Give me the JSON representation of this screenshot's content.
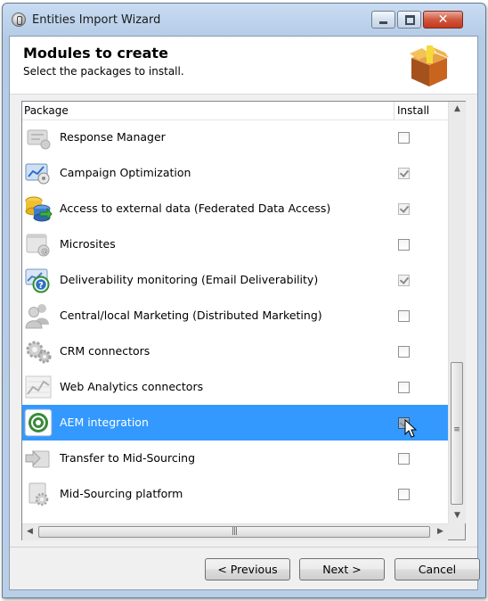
{
  "window": {
    "title": "Entities Import Wizard",
    "close_glyph": "✕"
  },
  "header": {
    "title": "Modules to create",
    "subtitle": "Select the packages to install.",
    "icon": "package-box-icon"
  },
  "list": {
    "columns": [
      "Package",
      "Install"
    ],
    "rows": [
      {
        "label": "Response Manager",
        "icon": "response-manager-icon",
        "checked": false,
        "enabled": true,
        "selected": false
      },
      {
        "label": "Campaign Optimization",
        "icon": "campaign-optimization-icon",
        "checked": true,
        "enabled": false,
        "selected": false
      },
      {
        "label": "Access to external data (Federated Data Access)",
        "icon": "database-icon",
        "checked": true,
        "enabled": false,
        "selected": false
      },
      {
        "label": "Microsites",
        "icon": "microsites-icon",
        "checked": false,
        "enabled": true,
        "selected": false
      },
      {
        "label": "Deliverability monitoring (Email Deliverability)",
        "icon": "deliverability-icon",
        "checked": true,
        "enabled": false,
        "selected": false
      },
      {
        "label": "Central/local Marketing (Distributed Marketing)",
        "icon": "users-icon",
        "checked": false,
        "enabled": true,
        "selected": false
      },
      {
        "label": "CRM connectors",
        "icon": "gears-icon",
        "checked": false,
        "enabled": true,
        "selected": false
      },
      {
        "label": "Web Analytics connectors",
        "icon": "chart-icon",
        "checked": false,
        "enabled": true,
        "selected": false
      },
      {
        "label": "AEM integration",
        "icon": "aem-icon",
        "checked": true,
        "enabled": true,
        "selected": true
      },
      {
        "label": "Transfer to Mid-Sourcing",
        "icon": "transfer-icon",
        "checked": false,
        "enabled": true,
        "selected": false
      },
      {
        "label": "Mid-Sourcing platform",
        "icon": "platform-icon",
        "checked": false,
        "enabled": true,
        "selected": false
      }
    ]
  },
  "scrollbar": {
    "up": "▲",
    "down": "▼",
    "left": "◀",
    "right": "▶",
    "v_grip": "≡",
    "h_grip": "|||"
  },
  "buttons": {
    "previous": "< Previous",
    "next": "Next >",
    "cancel": "Cancel"
  },
  "colors": {
    "selection": "#3399ff",
    "title_bar": "#c8dcf2"
  }
}
